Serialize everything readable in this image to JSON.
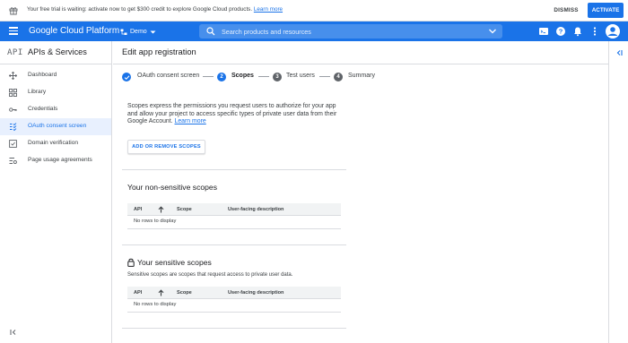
{
  "banner": {
    "text": "Your free trial is waiting: activate now to get $300 credit to explore Google Cloud products.",
    "link": "Learn more",
    "dismiss": "DISMISS",
    "activate": "ACTIVATE"
  },
  "topbar": {
    "product": "Google Cloud Platform",
    "project": "Demo",
    "search_placeholder": "Search products and resources"
  },
  "sidenav": {
    "logo": "API",
    "title": "APIs & Services",
    "items": [
      {
        "label": "Dashboard",
        "icon": "dashboard-icon"
      },
      {
        "label": "Library",
        "icon": "library-icon"
      },
      {
        "label": "Credentials",
        "icon": "key-icon"
      },
      {
        "label": "OAuth consent screen",
        "icon": "consent-icon",
        "active": true
      },
      {
        "label": "Domain verification",
        "icon": "domain-icon"
      },
      {
        "label": "Page usage agreements",
        "icon": "settings-list-icon"
      }
    ]
  },
  "main": {
    "title": "Edit app registration",
    "steps": [
      {
        "num": "",
        "label": "OAuth consent screen",
        "state": "done"
      },
      {
        "num": "2",
        "label": "Scopes",
        "state": "active"
      },
      {
        "num": "3",
        "label": "Test users",
        "state": "todo"
      },
      {
        "num": "4",
        "label": "Summary",
        "state": "todo"
      }
    ],
    "description": "Scopes express the permissions you request users to authorize for your app and allow your project to access specific types of private user data from their Google Account.",
    "description_link": "Learn more",
    "add_scopes_button": "ADD OR REMOVE SCOPES",
    "nonsensitive": {
      "title": "Your non-sensitive scopes",
      "columns": [
        "API",
        "Scope",
        "User-facing description"
      ],
      "empty": "No rows to display"
    },
    "sensitive": {
      "title": "Your sensitive scopes",
      "description": "Sensitive scopes are scopes that request access to private user data.",
      "columns": [
        "API",
        "Scope",
        "User-facing description"
      ],
      "empty": "No rows to display"
    }
  },
  "colors": {
    "accent": "#1a73e8",
    "nav_active_bg": "#e8f0fe",
    "done": "#1a73e8",
    "todo": "#5f6368"
  }
}
